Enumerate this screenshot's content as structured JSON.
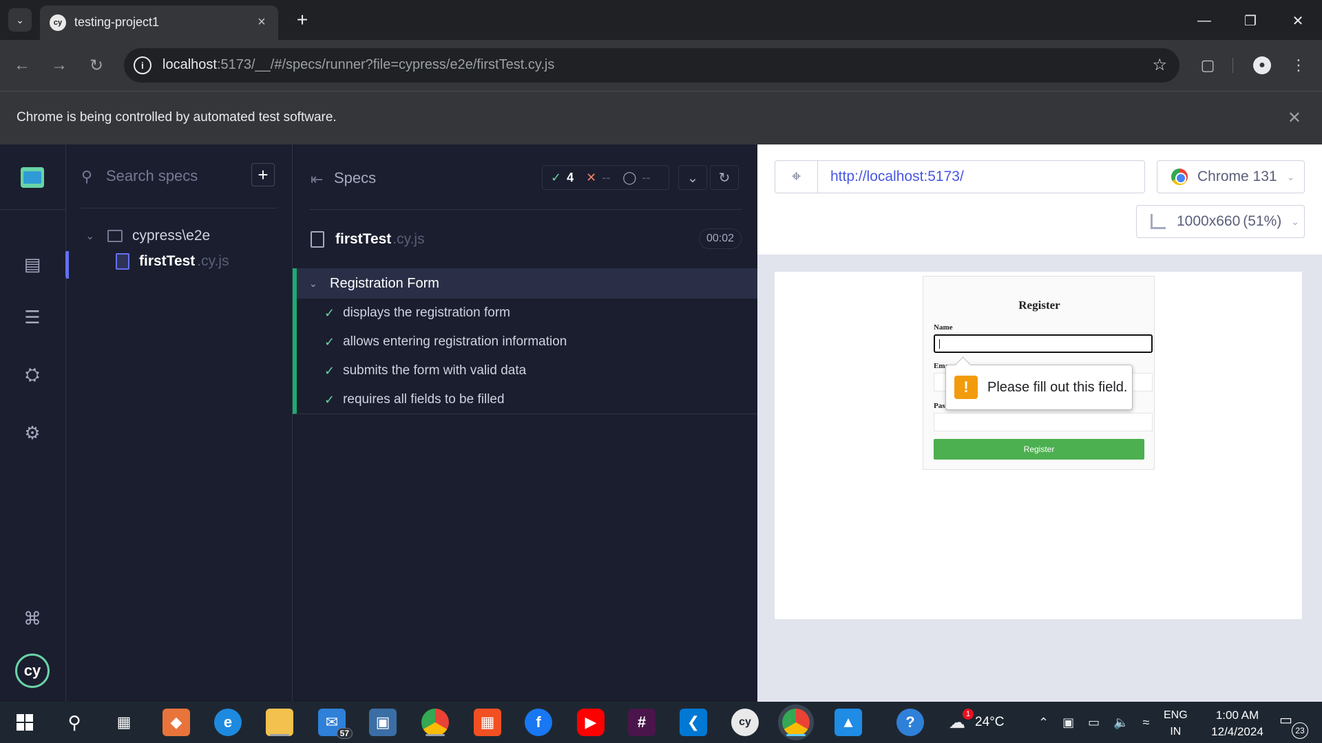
{
  "browser": {
    "tab_title": "testing-project1",
    "url_host": "localhost",
    "url_rest": ":5173/__/#/specs/runner?file=cypress/e2e/firstTest.cy.js",
    "infobar_text": "Chrome is being controlled by automated test software."
  },
  "specs_panel": {
    "search_placeholder": "Search specs",
    "folder": "cypress\\e2e",
    "file_name": "firstTest",
    "file_ext": ".cy.js"
  },
  "reporter": {
    "specs_label": "Specs",
    "passed": "4",
    "failed": "--",
    "pending": "--",
    "spec_name": "firstTest",
    "spec_ext": ".cy.js",
    "duration": "00:02",
    "suite_title": "Registration Form",
    "tests": [
      "displays the registration form",
      "allows entering registration information",
      "submits the form with valid data",
      "requires all fields to be filled"
    ]
  },
  "aut": {
    "url": "http://localhost:5173/",
    "browser": "Chrome 131",
    "viewport": "1000x660",
    "viewport_scale": "(51%)"
  },
  "app": {
    "title": "Register",
    "name_label": "Name",
    "email_label": "Email",
    "password_label": "Password",
    "submit": "Register",
    "tooltip": "Please fill out this field."
  },
  "taskbar": {
    "mail_badge": "57",
    "weather_temp": "24°C",
    "weather_badge": "1",
    "lang_line1": "ENG",
    "lang_line2": "IN",
    "time": "1:00 AM",
    "date": "12/4/2024",
    "notif_count": "23"
  },
  "colors": {
    "cypress_bg": "#1b1e2e",
    "pass_green": "#69d3a7",
    "accent_indigo": "#6470f3",
    "register_green": "#4caf50",
    "warning_orange": "#f29b0d"
  }
}
